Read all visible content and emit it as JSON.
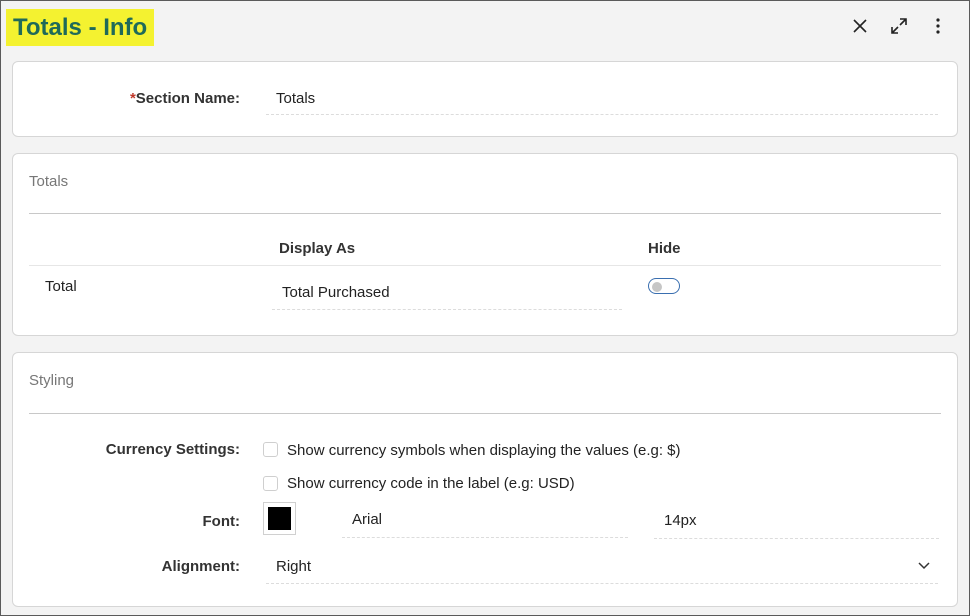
{
  "header": {
    "title": "Totals - Info",
    "title_bg": "#f4f230",
    "title_color": "#1f6a59",
    "icons": [
      "close-icon",
      "expand-icon",
      "more-vertical-icon"
    ]
  },
  "section_name": {
    "required_mark": "*",
    "label": "Section Name:",
    "value": "Totals"
  },
  "totals": {
    "title": "Totals",
    "columns": {
      "display_as": "Display As",
      "hide": "Hide"
    },
    "rows": [
      {
        "name": "Total",
        "display_as": "Total Purchased",
        "hide": false
      }
    ]
  },
  "styling": {
    "title": "Styling",
    "currency_label": "Currency Settings:",
    "currency_options": [
      {
        "label": "Show currency symbols when displaying the values (e.g: $)",
        "checked": false
      },
      {
        "label": "Show currency code in the label (e.g: USD)",
        "checked": false
      }
    ],
    "font_label": "Font:",
    "font_color": "#000000",
    "font_family": "Arial",
    "font_size": "14px",
    "alignment_label": "Alignment:",
    "alignment_value": "Right"
  }
}
